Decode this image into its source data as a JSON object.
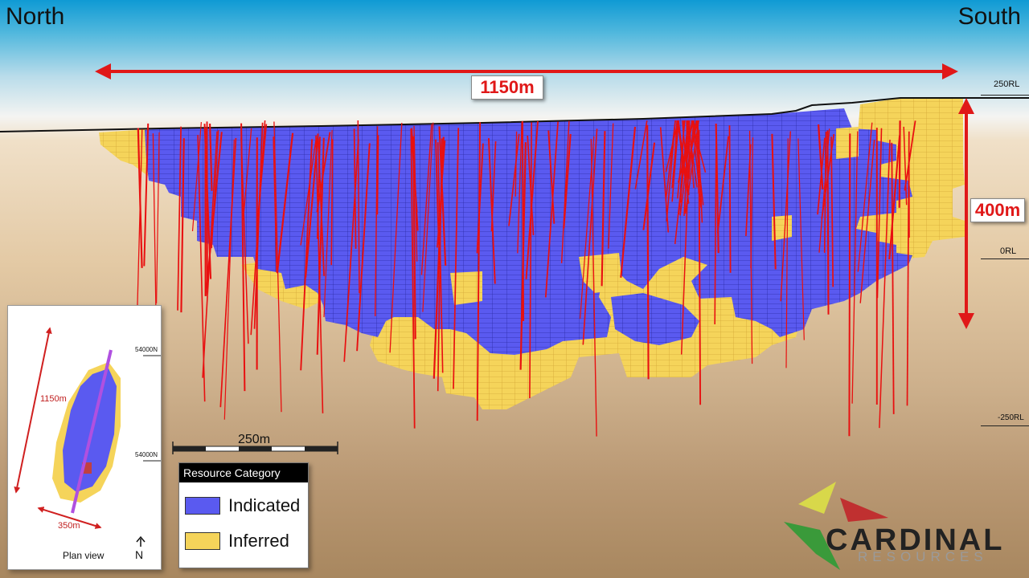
{
  "header": {
    "left_label": "North",
    "right_label": "South"
  },
  "dimensions": {
    "length_label": "1150m",
    "depth_label": "400m"
  },
  "levels": {
    "top": "250RL",
    "middle": "0RL",
    "bottom": "-250RL"
  },
  "scale_bar": {
    "label": "250m"
  },
  "legend": {
    "title": "Resource Category",
    "items": [
      {
        "label": "Indicated",
        "color": "#5a5af0"
      },
      {
        "label": "Inferred",
        "color": "#f5d45a"
      }
    ]
  },
  "inset": {
    "length_label": "1150m",
    "width_label": "350m",
    "northing_top": "54000N",
    "northing_bottom": "54000N",
    "caption": "Plan view",
    "north_label": "N"
  },
  "logo": {
    "name": "CARDINAL",
    "subtitle": "RESOURCES"
  },
  "colors": {
    "indicated": "#5a5af0",
    "inferred": "#f5d45a",
    "drillhole": "#e81010",
    "arrow": "#e01818"
  }
}
